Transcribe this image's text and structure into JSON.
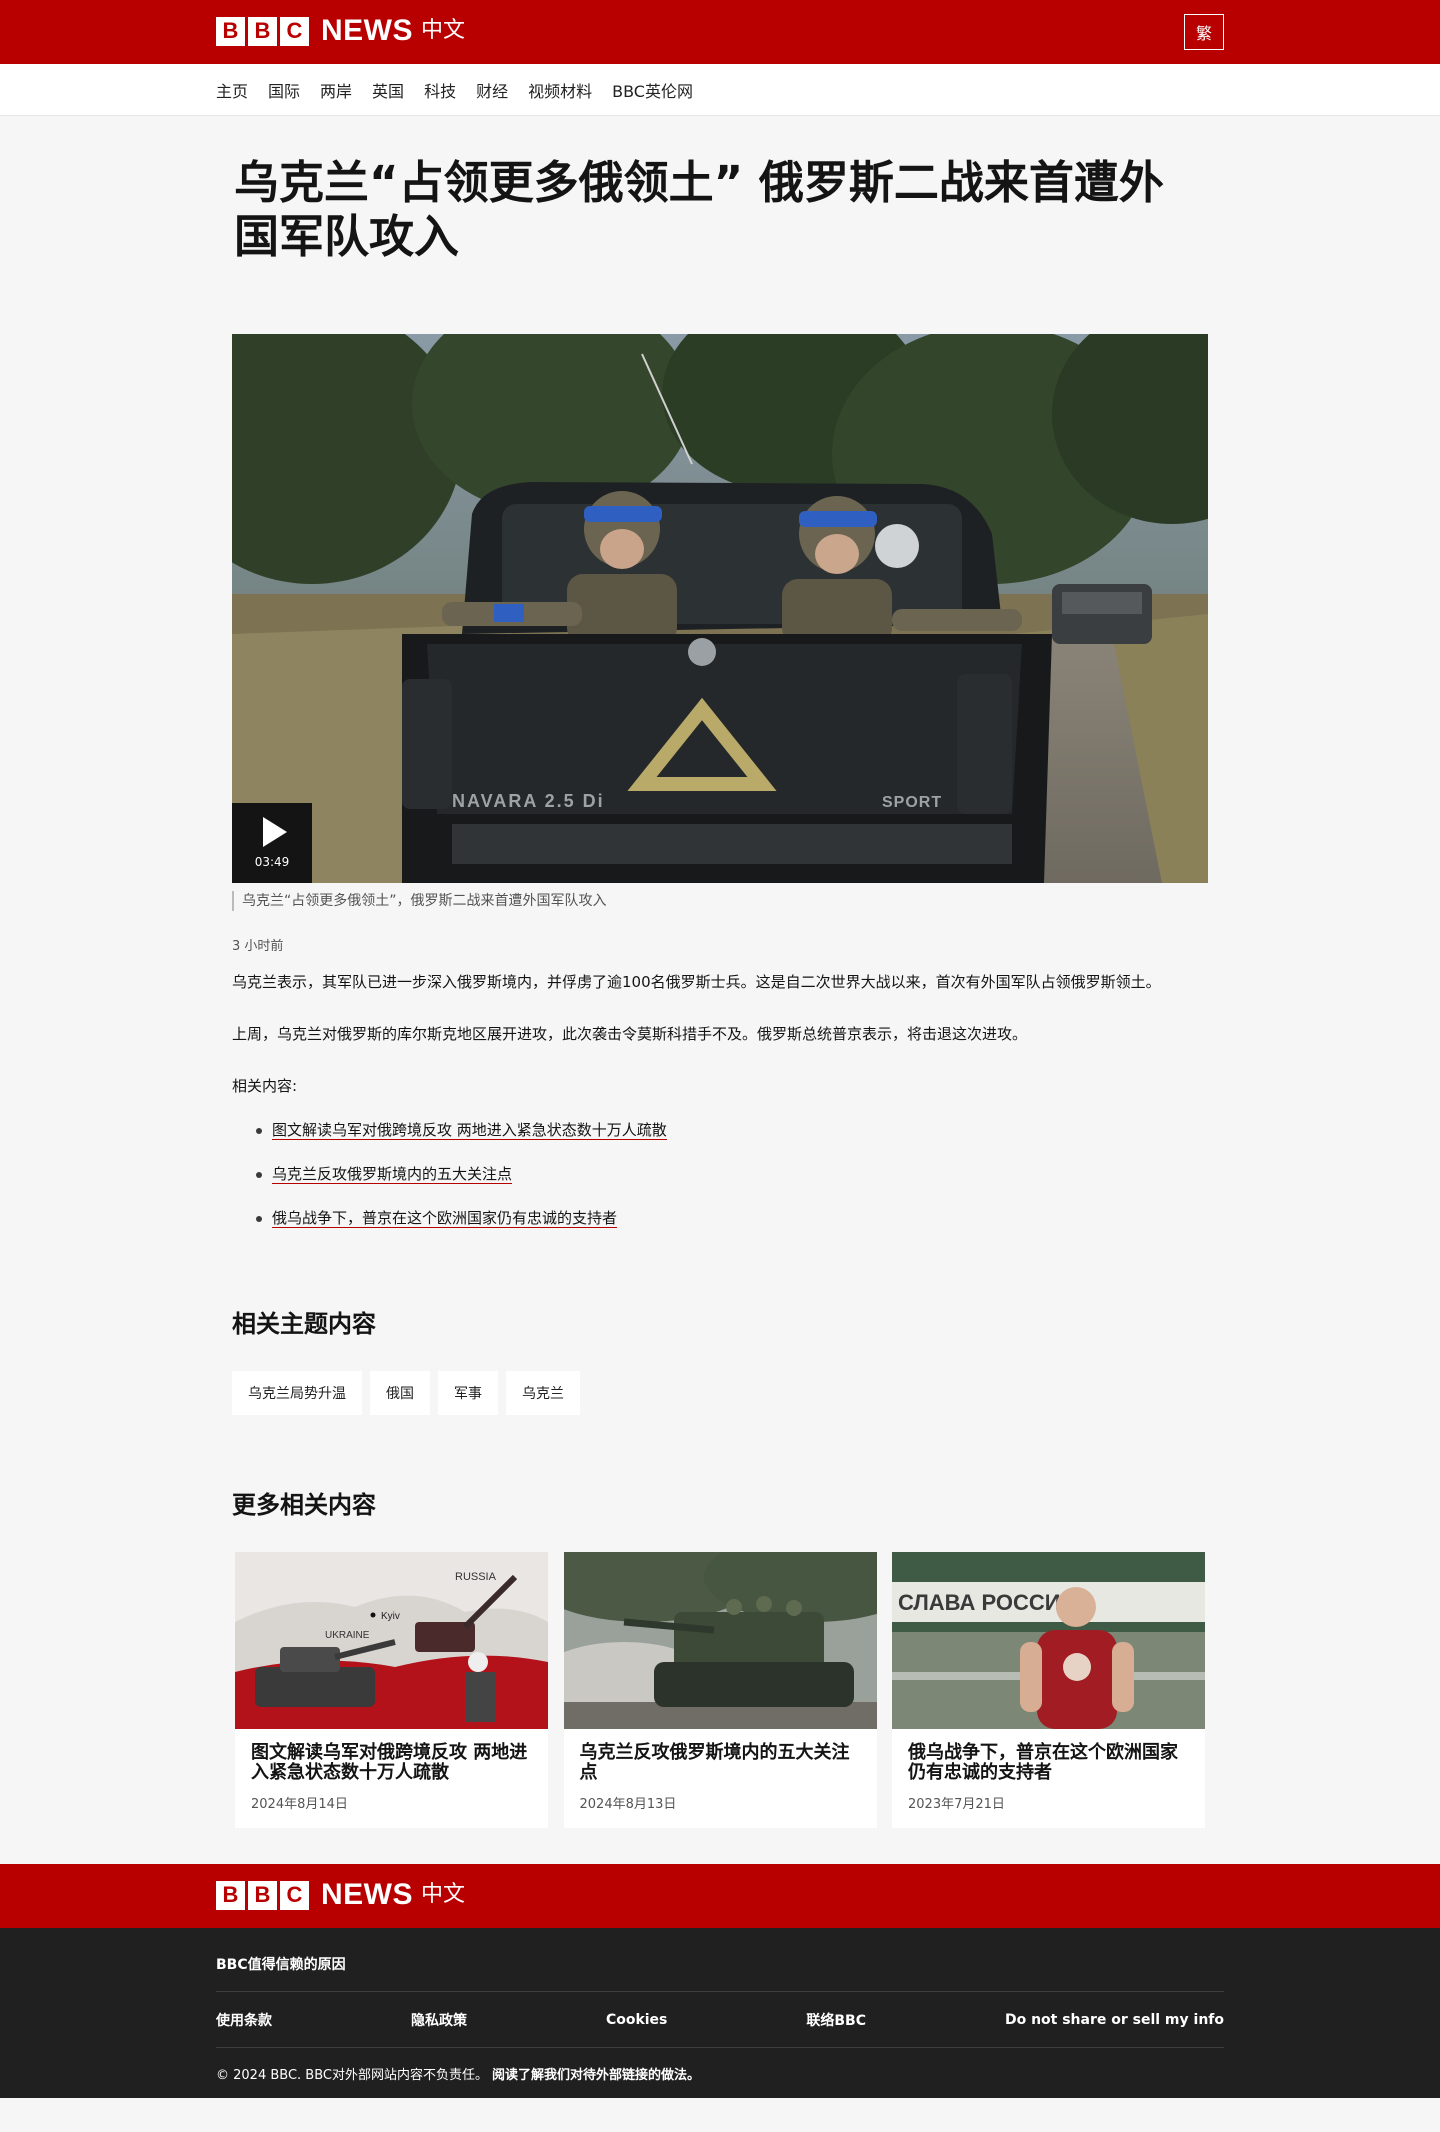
{
  "header": {
    "logo_letters": [
      "B",
      "B",
      "C"
    ],
    "news": "NEWS",
    "service": "中文",
    "traditional_toggle": "繁",
    "brand_color": "#b80000"
  },
  "nav": {
    "items": [
      "主页",
      "国际",
      "两岸",
      "英国",
      "科技",
      "财经",
      "视频材料",
      "BBC英伦网"
    ]
  },
  "article": {
    "headline": "乌克兰“占领更多俄领土” 俄罗斯二战来首遭外国军队攻入",
    "video": {
      "duration": "03:49",
      "caption": "乌克兰“占领更多俄领土”，俄罗斯二战来首遭外国军队攻入",
      "truck_text_left": "NAVARA 2.5 Di",
      "truck_text_right": "SPORT"
    },
    "timestamp": "3 小时前",
    "paragraphs": [
      "乌克兰表示，其军队已进一步深入俄罗斯境内，并俘虏了逾100名俄罗斯士兵。这是自二次世界大战以来，首次有外国军队占领俄罗斯领土。",
      "上周，乌克兰对俄罗斯的库尔斯克地区展开进攻，此次袭击令莫斯科措手不及。俄罗斯总统普京表示，将击退这次进攻。"
    ],
    "related_lead": "相关内容:",
    "related_links": [
      "图文解读乌军对俄跨境反攻 两地进入紧急状态数十万人疏散",
      "乌克兰反攻俄罗斯境内的五大关注点",
      "俄乌战争下，普京在这个欧洲国家仍有忠诚的支持者"
    ]
  },
  "topics": {
    "title": "相关主题内容",
    "items": [
      "乌克兰局势升温",
      "俄国",
      "军事",
      "乌克兰"
    ]
  },
  "more": {
    "title": "更多相关内容",
    "cards": [
      {
        "title": "图文解读乌军对俄跨境反攻 两地进入紧急状态数十万人疏散",
        "date": "2024年8月14日",
        "map_labels": [
          "RUSSIA",
          "Kyiv",
          "UKRAINE"
        ]
      },
      {
        "title": "乌克兰反攻俄罗斯境内的五大关注点",
        "date": "2024年8月13日"
      },
      {
        "title": "俄乌战争下，普京在这个欧洲国家仍有忠诚的支持者",
        "date": "2023年7月21日",
        "banner_text": "СЛАВА РОССИИ"
      }
    ]
  },
  "footer": {
    "trust": "BBC值得信赖的原因",
    "links": [
      "使用条款",
      "隐私政策",
      "Cookies",
      "联络BBC",
      "Do not share or sell my info"
    ],
    "copyright": "© 2024 BBC. BBC对外部网站内容不负责任。",
    "external_policy": "阅读了解我们对待外部链接的做法。"
  }
}
